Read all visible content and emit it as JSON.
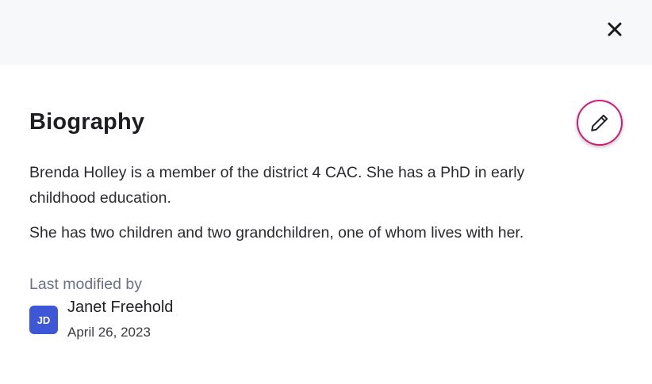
{
  "header": {
    "close_icon": "close-icon"
  },
  "panel": {
    "title": "Biography",
    "edit_icon": "pencil-icon",
    "accent_color": "#d4187a",
    "paragraphs": [
      "Brenda Holley is a member of the district 4 CAC. She has a PhD in early childhood education.",
      "She has two children and two grandchildren, one of whom lives with her."
    ]
  },
  "modified": {
    "label": "Last modified by",
    "user_initials": "JD",
    "user_name": "Janet Freehold",
    "date": "April 26, 2023",
    "avatar_color": "#3d57d6"
  }
}
